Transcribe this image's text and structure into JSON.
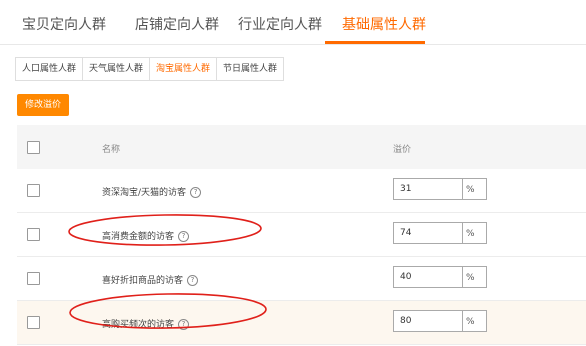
{
  "top_tabs": [
    "宝贝定向人群",
    "店铺定向人群",
    "行业定向人群",
    "基础属性人群"
  ],
  "sub_tabs": [
    "人口属性人群",
    "天气属性人群",
    "淘宝属性人群",
    "节日属性人群"
  ],
  "modify_button": "修改溢价",
  "table": {
    "headers": {
      "name": "名称",
      "price": "溢价"
    },
    "rows": [
      {
        "name": "资深淘宝/天猫的访客",
        "price": "31",
        "unit": "%"
      },
      {
        "name": "高消费金额的访客",
        "price": "74",
        "unit": "%"
      },
      {
        "name": "喜好折扣商品的访客",
        "price": "40",
        "unit": "%"
      },
      {
        "name": "高购买频次的访客",
        "price": "80",
        "unit": "%"
      }
    ]
  },
  "help_glyph": "?",
  "colors": {
    "accent": "#ff6a00",
    "button": "#ff8800",
    "annotation": "#e0201a",
    "highlight_row": "#fdf7ef"
  }
}
